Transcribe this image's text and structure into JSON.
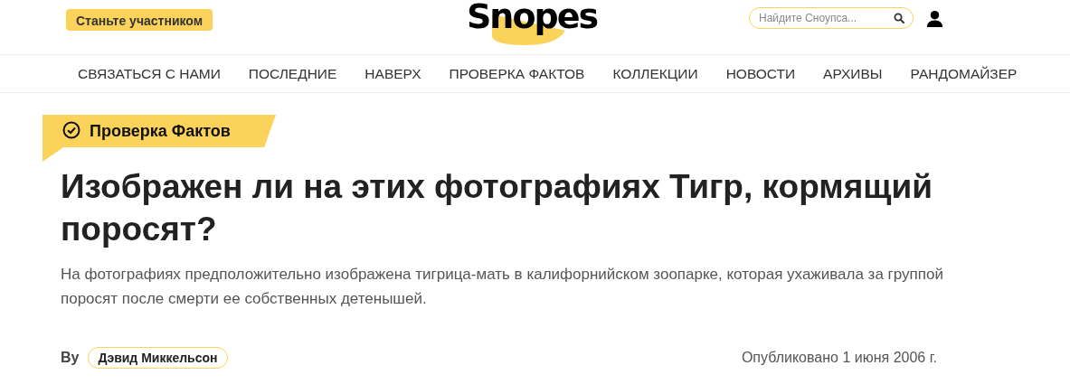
{
  "header": {
    "join_button": "Станьте участником",
    "logo": "Snopes",
    "search": {
      "placeholder": "Найдите Сноупса..."
    }
  },
  "nav": [
    {
      "label": "СВЯЗАТЬСЯ С НАМИ"
    },
    {
      "label": "ПОСЛЕДНИЕ"
    },
    {
      "label": "НАВЕРХ"
    },
    {
      "label": "ПРОВЕРКА ФАКТОВ"
    },
    {
      "label": "КОЛЛЕКЦИИ"
    },
    {
      "label": "НОВОСТИ"
    },
    {
      "label": "АРХИВЫ"
    },
    {
      "label": "РАНДОМАЙЗЕР"
    }
  ],
  "article": {
    "category": "Проверка Фактов",
    "title": "Изображен ли на этих фотографиях Тигр, кормящий поросят?",
    "subtitle": "На фотографиях предположительно изображена тигрица-мать в калифорнийском зоопарке, которая ухаживала за группой поросят после смерти ее собственных детенышей.",
    "by": "By",
    "author": "Дэвид Миккельсон",
    "published": "Опубликовано 1 июня 2006 г."
  }
}
